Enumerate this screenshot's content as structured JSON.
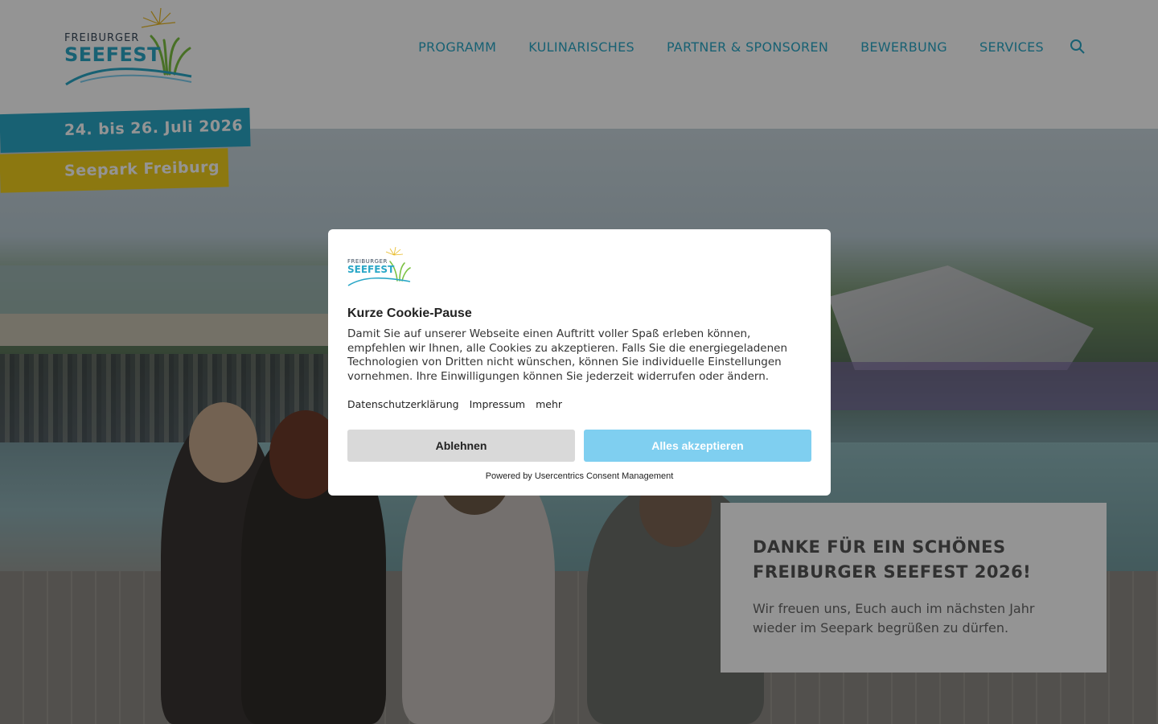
{
  "header": {
    "logo_line1": "FREIBURGER",
    "logo_line2": "SEEFEST",
    "nav": [
      "PROGRAMM",
      "KULINARISCHES",
      "PARTNER & SPONSOREN",
      "BEWERBUNG",
      "SERVICES"
    ],
    "search_icon": "search-icon"
  },
  "hero": {
    "date": "24. bis 26. Juli 2026",
    "location": "Seepark Freiburg"
  },
  "infobox": {
    "title": "DANKE FÜR EIN SCHÖNES FREIBURGER SEEFEST 2026!",
    "text": "Wir freuen uns, Euch auch im nächsten Jahr wieder im Seepark begrüßen zu dürfen."
  },
  "cookie": {
    "logo_line1": "FREIBURGER",
    "logo_line2": "SEEFEST",
    "title": "Kurze Cookie-Pause",
    "description": "Damit Sie auf unserer Webseite einen Auftritt voller Spaß erleben können, empfehlen wir Ihnen, alle Cookies zu akzeptieren. Falls Sie die energiegeladenen Technologien von Dritten nicht wünschen, können Sie individuelle Einstellungen vornehmen. Ihre Einwilligungen können Sie jederzeit widerrufen oder ändern.",
    "links": [
      "Datenschutzerklärung",
      "Impressum",
      "mehr"
    ],
    "deny_label": "Ablehnen",
    "accept_label": "Alles akzeptieren",
    "powered": "Powered by Usercentrics Consent Management"
  },
  "colors": {
    "brand_blue": "#2aa7c7",
    "brand_yellow": "#f2cf1d",
    "accept_button": "#7fcff0"
  }
}
